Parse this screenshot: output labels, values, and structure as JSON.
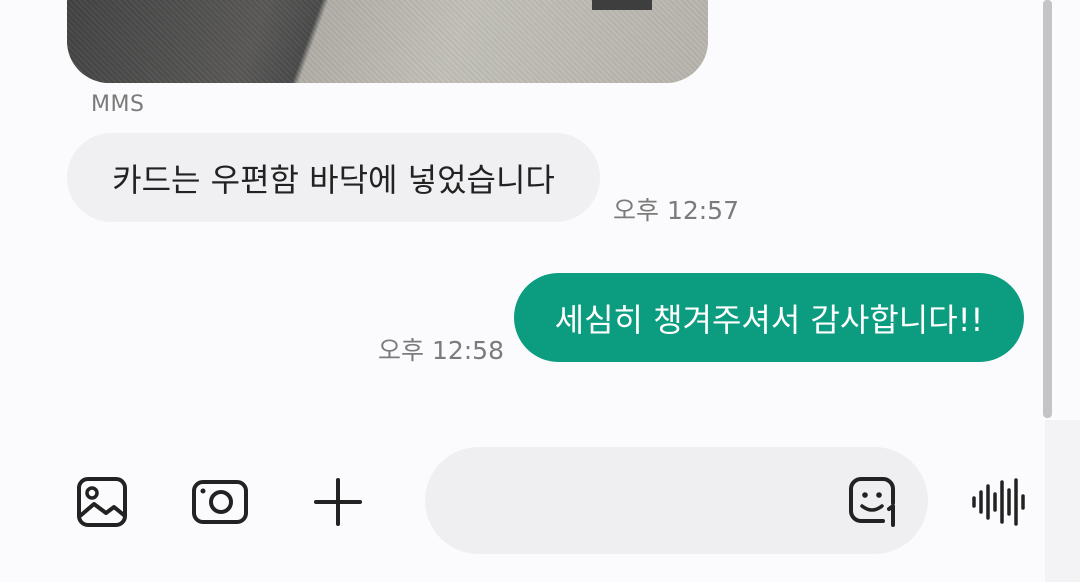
{
  "message_type_label": "MMS",
  "messages": [
    {
      "direction": "incoming",
      "text": "카드는 우편함 바닥에 넣었습니다",
      "time": "오후 12:57"
    },
    {
      "direction": "outgoing",
      "text": "세심히 챙겨주셔서 감사합니다!!",
      "time": "오후 12:58"
    }
  ],
  "composer": {
    "input_value": "",
    "buttons": [
      {
        "name": "gallery",
        "icon": "image-icon"
      },
      {
        "name": "camera",
        "icon": "camera-icon"
      },
      {
        "name": "more",
        "icon": "plus-icon"
      },
      {
        "name": "sticker",
        "icon": "sticker-icon"
      },
      {
        "name": "voice",
        "icon": "voice-wave-icon"
      }
    ]
  },
  "colors": {
    "outgoing_bubble": "#0c9c80",
    "incoming_bubble": "#f0f0f2",
    "background": "#fbfbfd"
  }
}
